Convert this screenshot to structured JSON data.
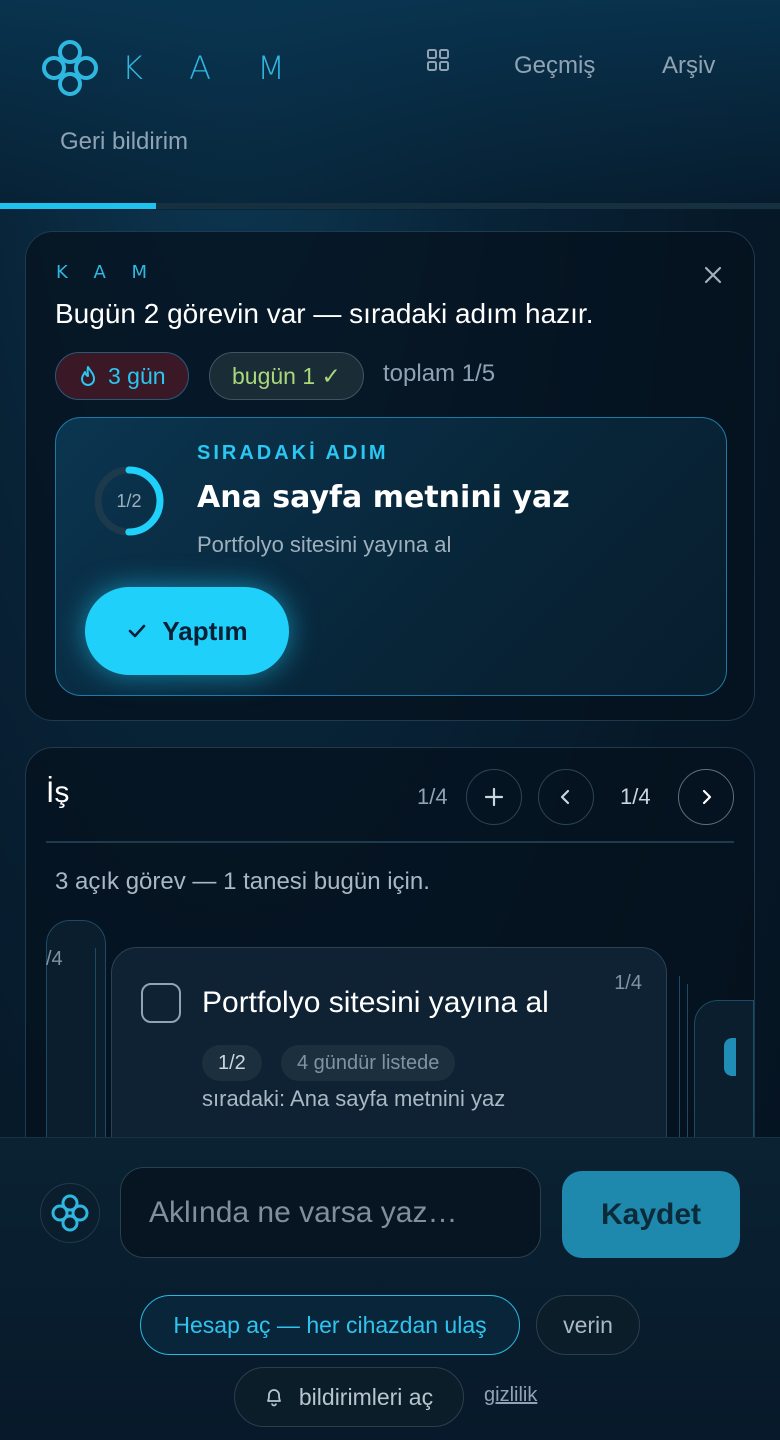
{
  "header": {
    "brand": "K A M",
    "nav": {
      "history": "Geçmiş",
      "archive": "Arşiv",
      "feedback": "Geri bildirim"
    },
    "progress": 0.2
  },
  "today_card": {
    "brand": "K A M",
    "headline": "Bugün 2 görevin var — sıradaki adım hazır.",
    "streak": "3 gün",
    "today": "bugün 1 ✓",
    "total": "toplam 1/5",
    "next_step": {
      "kicker": "SIRADAKİ ADIM",
      "title": "Ana sayfa metnini yaz",
      "project": "Portfolyo sitesini yayına al",
      "progress_label": "1/2",
      "progress": 0.5,
      "done_label": "Yaptım"
    }
  },
  "work_card": {
    "title": "İş",
    "count": "1/4",
    "page": "1/4",
    "summary": "3 açık görev — 1 tanesi bugün için.",
    "left_peek_label": "/4",
    "task": {
      "title": "Portfolyo sitesini yayına al",
      "fraction": "1/4",
      "step_tag": "1/2",
      "age_tag": "4 gündür listede",
      "next": "sıradaki: Ana sayfa metnini yaz"
    }
  },
  "composer": {
    "placeholder": "Aklında ne varsa yaz…",
    "save_label": "Kaydet",
    "account_label": "Hesap aç — her cihazdan ulaş",
    "data_label": "verin",
    "notifications_label": "bildirimleri aç",
    "privacy_label": "gizlilik"
  },
  "colors": {
    "accent": "#1fd0fb",
    "brand": "#2fb7e0",
    "success": "#a9d87a"
  }
}
